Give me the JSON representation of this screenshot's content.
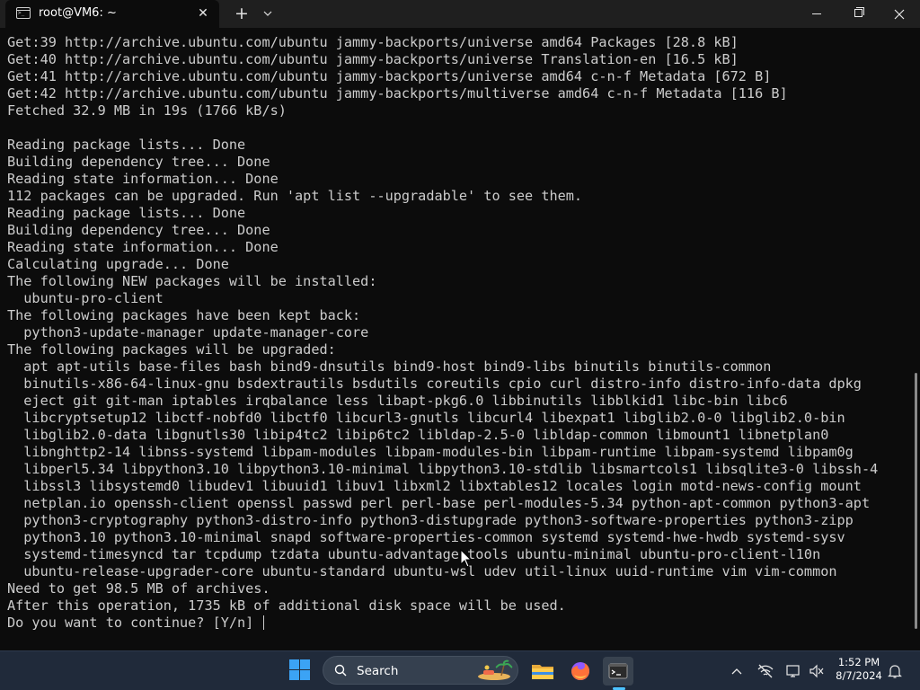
{
  "window": {
    "tab_title": "root@VM6: ~",
    "tab_close": "✕",
    "new_tab": "+",
    "tab_dropdown": "⌵"
  },
  "terminal": {
    "lines": [
      "Get:39 http://archive.ubuntu.com/ubuntu jammy-backports/universe amd64 Packages [28.8 kB]",
      "Get:40 http://archive.ubuntu.com/ubuntu jammy-backports/universe Translation-en [16.5 kB]",
      "Get:41 http://archive.ubuntu.com/ubuntu jammy-backports/universe amd64 c-n-f Metadata [672 B]",
      "Get:42 http://archive.ubuntu.com/ubuntu jammy-backports/multiverse amd64 c-n-f Metadata [116 B]",
      "Fetched 32.9 MB in 19s (1766 kB/s)",
      "",
      "Reading package lists... Done",
      "Building dependency tree... Done",
      "Reading state information... Done",
      "112 packages can be upgraded. Run 'apt list --upgradable' to see them.",
      "Reading package lists... Done",
      "Building dependency tree... Done",
      "Reading state information... Done",
      "Calculating upgrade... Done",
      "The following NEW packages will be installed:",
      "  ubuntu-pro-client",
      "The following packages have been kept back:",
      "  python3-update-manager update-manager-core",
      "The following packages will be upgraded:",
      "  apt apt-utils base-files bash bind9-dnsutils bind9-host bind9-libs binutils binutils-common",
      "  binutils-x86-64-linux-gnu bsdextrautils bsdutils coreutils cpio curl distro-info distro-info-data dpkg",
      "  eject git git-man iptables irqbalance less libapt-pkg6.0 libbinutils libblkid1 libc-bin libc6",
      "  libcryptsetup12 libctf-nobfd0 libctf0 libcurl3-gnutls libcurl4 libexpat1 libglib2.0-0 libglib2.0-bin",
      "  libglib2.0-data libgnutls30 libip4tc2 libip6tc2 libldap-2.5-0 libldap-common libmount1 libnetplan0",
      "  libnghttp2-14 libnss-systemd libpam-modules libpam-modules-bin libpam-runtime libpam-systemd libpam0g",
      "  libperl5.34 libpython3.10 libpython3.10-minimal libpython3.10-stdlib libsmartcols1 libsqlite3-0 libssh-4",
      "  libssl3 libsystemd0 libudev1 libuuid1 libuv1 libxml2 libxtables12 locales login motd-news-config mount",
      "  netplan.io openssh-client openssl passwd perl perl-base perl-modules-5.34 python-apt-common python3-apt",
      "  python3-cryptography python3-distro-info python3-distupgrade python3-software-properties python3-zipp",
      "  python3.10 python3.10-minimal snapd software-properties-common systemd systemd-hwe-hwdb systemd-sysv",
      "  systemd-timesyncd tar tcpdump tzdata ubuntu-advantage-tools ubuntu-minimal ubuntu-pro-client-l10n",
      "  ubuntu-release-upgrader-core ubuntu-standard ubuntu-wsl udev util-linux uuid-runtime vim vim-common",
      "Need to get 98.5 MB of archives.",
      "After this operation, 1735 kB of additional disk space will be used.",
      "Do you want to continue? [Y/n] "
    ]
  },
  "taskbar": {
    "search_label": "Search",
    "time": "1:52 PM",
    "date": "8/7/2024"
  },
  "colors": {
    "terminal_bg": "#0c0c0c",
    "terminal_fg": "#cccccc",
    "taskbar_bg": "#202a3a",
    "accent": "#4cc2ff"
  }
}
